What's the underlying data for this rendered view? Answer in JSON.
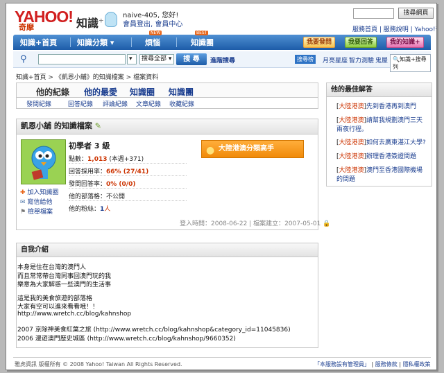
{
  "brand": {
    "logo": "YAHOO!",
    "logo_sub": "奇摩",
    "product": "知識",
    "plus": "+"
  },
  "user": {
    "greeting": "naive-405, 您好!",
    "links": "會員登出, 會員中心"
  },
  "top": {
    "search_btn": "搜尋網頁",
    "links": "服務首頁 | 服務說明 | Yahoo!奇摩"
  },
  "nav": {
    "items": [
      "知識+首頁",
      "知識分類 ▾",
      "煩惱",
      "知識團"
    ],
    "badges": [
      "NEW",
      "BEST"
    ],
    "actions": [
      "我要發問",
      "我要回答",
      "我的知識+"
    ]
  },
  "search": {
    "scope": "搜尋全部",
    "button": "搜 尋",
    "advanced": "進階搜尋",
    "hot_label": "搜尋榜",
    "hot_links": [
      "月亮星座",
      "智力測驗",
      "鬼屋"
    ],
    "tool": "知識+搜尋列"
  },
  "breadcrumb": "知識+首頁 > 《凱恩小舖》的知識檔案 > 檔案資料",
  "tabs": [
    "他的紀錄",
    "他的最愛",
    "知識圈",
    "知識團"
  ],
  "subtabs": [
    "發問紀錄",
    "回答紀錄",
    "評論紀錄",
    "文章紀錄",
    "收藏紀錄"
  ],
  "profile": {
    "title": "凱恩小舖 的知識檔案",
    "level": "初學者 3 級",
    "badge": "大陸港澳分類高手",
    "rows": [
      {
        "label": "點數：",
        "value": "1,013",
        "extra": "(本週+371)"
      },
      {
        "label": "回答採用率：",
        "value": "66% (27/41)"
      },
      {
        "label": "發問回答率：",
        "value": "0% (0/0)"
      },
      {
        "label": "他的部落格：",
        "value": "不公開"
      },
      {
        "label": "他的粉絲：",
        "value": "1",
        "unit": "人"
      }
    ],
    "side_links": [
      "加入知識圈",
      "寫信給他",
      "檢舉檔案"
    ],
    "login_time": "登入時間：2008-06-22",
    "created": "檔案建立：2007-05-01"
  },
  "intro": {
    "title": "自我介紹",
    "lines": [
      "本身是住在台灣的澳門人",
      "而且常常帶台灣同事回澳門玩的我",
      "樂意為大家解惑一些澳門的生活事",
      "",
      "這是我的美食旅遊的部落格",
      "大家有空可以進來看看哦！！",
      "http://www.wretch.cc/blog/kahnshop",
      "",
      "2007 京除神美食紅葉之旅 (http://www.wretch.cc/blog/kahnshop&category_id=11045836)",
      "2006 漫遊澳門歷史城區 (http://www.wretch.cc/blog/kahnshop/9660352)"
    ]
  },
  "best": {
    "title": "他的最佳解答",
    "items": [
      {
        "cat": "大陸港澳",
        "text": "先到香港再到澳門"
      },
      {
        "cat": "大陸港澳",
        "text": "請幫我規劃澳門三天兩夜行程。"
      },
      {
        "cat": "大陸港澳",
        "text": "如何去廣東湛江大學?"
      },
      {
        "cat": "大陸港澳",
        "text": "辦理香港簽證問題"
      },
      {
        "cat": "大陸港澳",
        "text": "澳門至香港國際機場的問題"
      }
    ]
  },
  "footer": {
    "copyright": "雅虎資訊 版權所有 © 2008 Yahoo! Taiwan All Rights Reserved.",
    "links": [
      "「本服務設有管理員」",
      "服務條款",
      "隱私權政策"
    ]
  },
  "colors": {
    "nav": "#1d5ca8",
    "accent": "#f08a0a",
    "link": "#1a3d8f",
    "points": "#c30"
  }
}
